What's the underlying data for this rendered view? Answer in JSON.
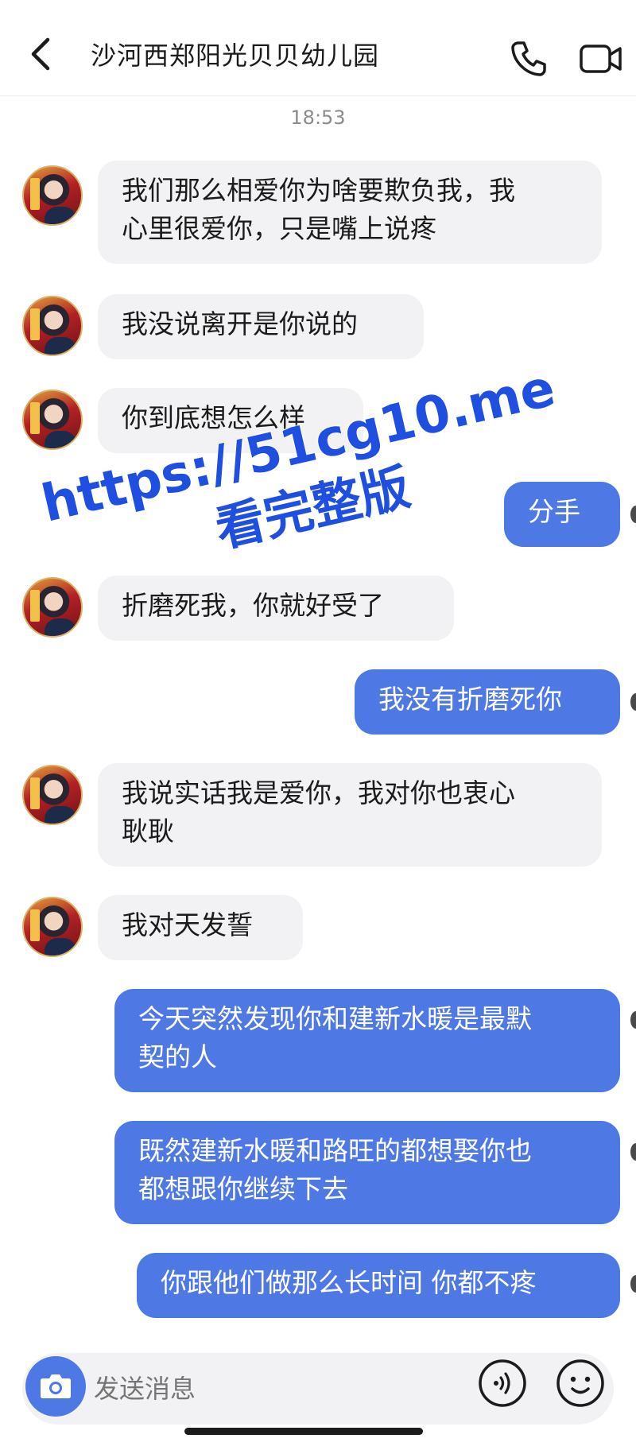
{
  "header": {
    "title": "沙河西郑阳光贝贝幼儿园",
    "back_icon": "chevron-left-icon",
    "call_icon": "phone-icon",
    "video_icon": "video-camera-icon"
  },
  "timestamp": "18:53",
  "messages": [
    {
      "side": "in",
      "lines": [
        "我们那么相爱你为啥要欺负我，我",
        "心里很爱你，只是嘴上说疼"
      ]
    },
    {
      "side": "in",
      "lines": [
        "我没说离开是你说的"
      ]
    },
    {
      "side": "in",
      "lines": [
        "你到底想怎么样"
      ]
    },
    {
      "side": "out",
      "lines": [
        "分手"
      ]
    },
    {
      "side": "in",
      "lines": [
        "折磨死我，你就好受了"
      ]
    },
    {
      "side": "out",
      "lines": [
        "我没有折磨死你"
      ]
    },
    {
      "side": "in",
      "lines": [
        "我说实话我是爱你，我对你也衷心",
        "耿耿"
      ]
    },
    {
      "side": "in",
      "lines": [
        "我对天发誓"
      ]
    },
    {
      "side": "out",
      "lines": [
        "今天突然发现你和建新水暖是最默",
        "契的人"
      ]
    },
    {
      "side": "out",
      "lines": [
        "既然建新水暖和路旺的都想娶你也",
        "都想跟你继续下去"
      ]
    },
    {
      "side": "out",
      "lines": [
        "你跟他们做那么长时间 你都不疼"
      ]
    }
  ],
  "watermark": {
    "url": "https://51cg10.me",
    "subtitle": "看完整版"
  },
  "input": {
    "placeholder": "发送消息",
    "camera_icon": "camera-icon",
    "voice_icon": "voice-icon",
    "emoji_icon": "emoji-icon"
  },
  "colors": {
    "outgoing_bubble": "#4e79e5",
    "incoming_bubble": "#f2f2f4",
    "watermark": "#1f4fe0"
  }
}
